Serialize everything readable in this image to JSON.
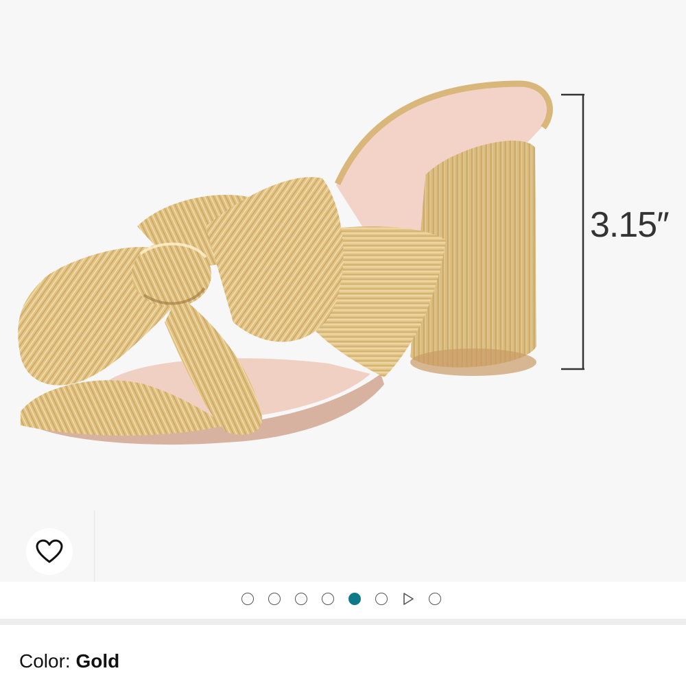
{
  "product": {
    "dimension_label": "3.15″",
    "image_alt": "Gold pleated bow heeled mule sandal"
  },
  "wishlist": {
    "icon": "heart-outline-icon"
  },
  "carousel": {
    "slides": [
      {
        "type": "image",
        "active": false
      },
      {
        "type": "image",
        "active": false
      },
      {
        "type": "image",
        "active": false
      },
      {
        "type": "image",
        "active": false
      },
      {
        "type": "image",
        "active": true
      },
      {
        "type": "image",
        "active": false
      },
      {
        "type": "video",
        "active": false
      },
      {
        "type": "image",
        "active": false
      }
    ],
    "active_color": "#0d7a8a"
  },
  "variation": {
    "color_label": "Color: ",
    "color_value": "Gold"
  }
}
